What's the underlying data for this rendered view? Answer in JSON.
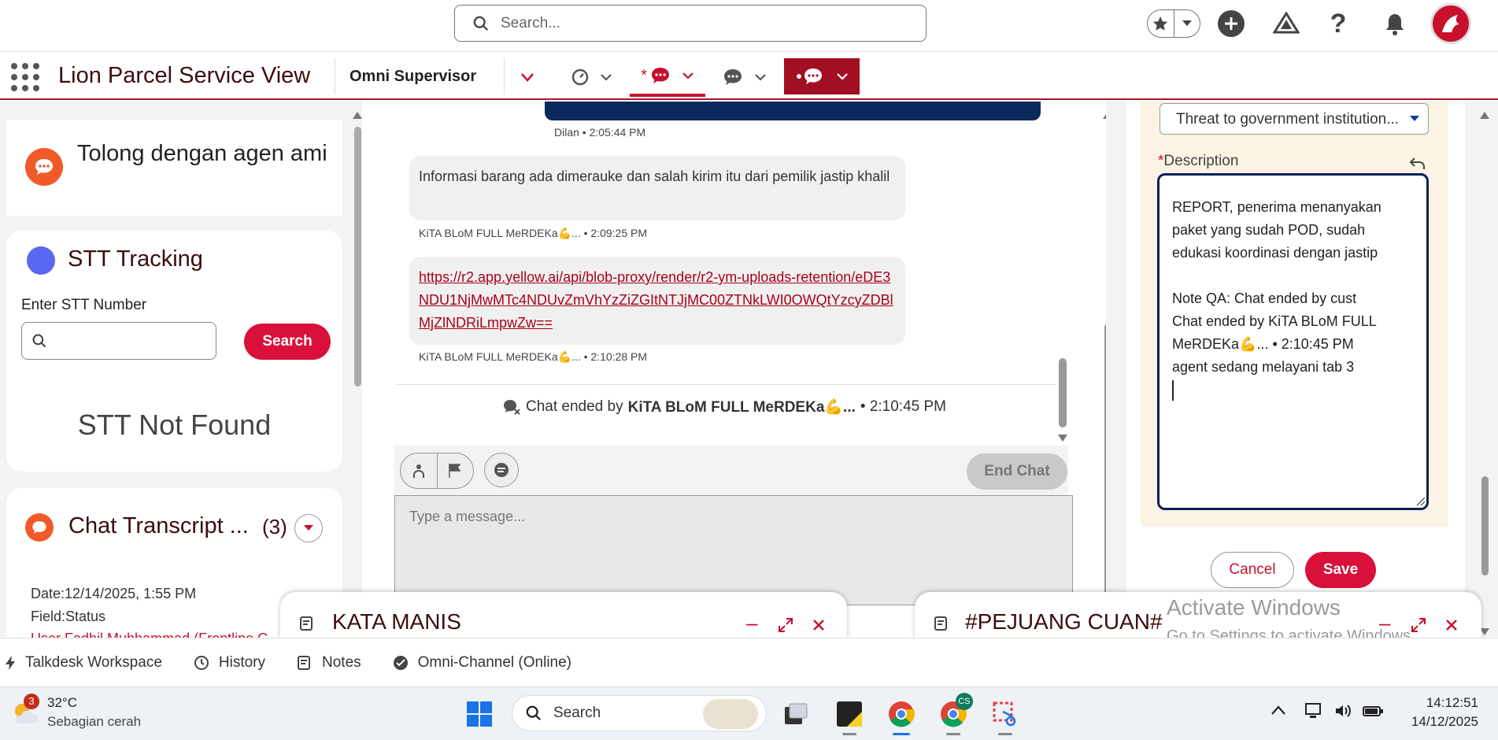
{
  "header": {
    "search_placeholder": "Search..."
  },
  "nav": {
    "app_name": "Lion Parcel Service View",
    "workspace_tab": "Omni Supervisor",
    "active_tab_prefix": "*"
  },
  "left": {
    "chat_card_title": "Tolong dengan agen ami",
    "tracking": {
      "title": "STT Tracking",
      "input_label": "Enter STT Number",
      "search_button": "Search",
      "status": "STT Not Found"
    },
    "transcript": {
      "title": "Chat Transcript ...",
      "count": "(3)",
      "date_line": "Date:12/14/2025, 1:55 PM",
      "field_line": "Field:Status",
      "cut_line": "User Fadhil Muhhammad (Frontline C..."
    }
  },
  "chat": {
    "top_meta": "Dilan • 2:05:44 PM",
    "msg1_text": "Informasi barang ada dimerauke dan salah kirim itu dari pemilik jastip khalil",
    "msg1_meta": "KiTA BLoM FULL MeRDEKa💪... • 2:09:25 PM",
    "msg2_link": "https://r2.app.yellow.ai/api/blob-proxy/render/r2-ym-uploads-retention/eDE3NDU1NjMwMTc4NDUvZmVhYzZiZGItNTJjMC00ZTNkLWI0OWQtYzcyZDBlMjZlNDRiLmpwZw==",
    "msg2_meta": "KiTA BLoM FULL MeRDEKa💪... • 2:10:28 PM",
    "ended_prefix": "Chat ended by",
    "ended_name": "KiTA BLoM FULL MeRDEKa💪...",
    "ended_time": "• 2:10:45 PM",
    "end_chat_button": "End Chat",
    "composer_placeholder": "Type a message..."
  },
  "form": {
    "picklist_value": "Threat to government institution...",
    "required_mark": "*",
    "description_label": "Description",
    "description_value": "REPORT, penerima menanyakan paket yang sudah POD, sudah edukasi koordinasi dengan jastip\n\nNote QA: Chat ended by cust\nChat ended by KiTA BLoM FULL MeRDEKa💪... • 2:10:45 PM\nagent sedang melayani tab 3",
    "cancel_button": "Cancel",
    "save_button": "Save"
  },
  "docked": [
    {
      "title": "KATA MANIS"
    },
    {
      "title": "#PEJUANG CUAN#"
    }
  ],
  "watermark": {
    "line1": "Activate Windows",
    "line2": "Go to Settings to activate Windows."
  },
  "utility": [
    {
      "label": "Talkdesk Workspace",
      "icon": "bolt-icon"
    },
    {
      "label": "History",
      "icon": "clock-icon"
    },
    {
      "label": "Notes",
      "icon": "notes-icon"
    },
    {
      "label": "Omni-Channel (Online)",
      "icon": "check-circle-icon"
    }
  ],
  "taskbar": {
    "weather_badge": "3",
    "temp": "32°C",
    "condition": "Sebagian cerah",
    "search_label": "Search",
    "time": "14:12:51",
    "date": "14/12/2025",
    "chrome_badge": "CS"
  },
  "colors": {
    "brand_red": "#c8102e",
    "dark_red": "#a20e22",
    "navy": "#0a1f5c",
    "chat_orange": "#f05a28",
    "tracking_blue": "#5a67f0"
  }
}
